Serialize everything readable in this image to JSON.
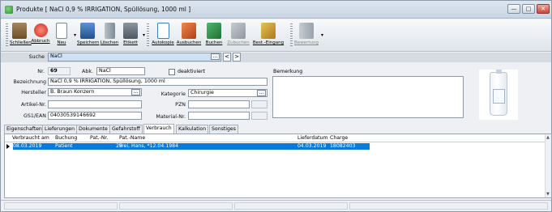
{
  "window": {
    "title": "Produkte [ NaCl 0,9 % IRRIGATION, Spüllösung, 1000 ml ]",
    "controls": {
      "minimize": "—",
      "maximize": "□",
      "close": "✕"
    }
  },
  "toolbar": {
    "buttons": [
      {
        "label": "Schließen",
        "icon": "exit-door-icon",
        "color": "#7a5a2e"
      },
      {
        "label": "Abbruch",
        "icon": "cancel-circle-icon",
        "color": "#d23a2e"
      },
      {
        "label": "Neu",
        "icon": "new-document-icon",
        "color": "#ffffff"
      },
      {
        "label": "Speichern",
        "icon": "floppy-disk-icon",
        "color": "#2f6fb5"
      },
      {
        "label": "Löschen",
        "icon": "trash-icon",
        "color": "#7f8b96"
      },
      {
        "label": "Etikett",
        "icon": "printer-icon",
        "color": "#5d6770"
      },
      {
        "label": "Autokopie",
        "icon": "copy-documents-icon",
        "color": "#3f7ec7"
      },
      {
        "label": "Ausbuchen",
        "icon": "book-out-icon",
        "color": "#d8572a"
      },
      {
        "label": "Buchen",
        "icon": "book-in-icon",
        "color": "#2a8f43"
      },
      {
        "label": "Zubuchen",
        "icon": "add-booking-icon",
        "color": "#9aa3ab"
      },
      {
        "label": "Best.-Eingang",
        "icon": "goods-receipt-icon",
        "color": "#c99a2a"
      },
      {
        "label": "Bewertung",
        "icon": "rating-chart-icon",
        "color": "#a7afb7"
      }
    ]
  },
  "search": {
    "label": "Suche",
    "value": "NaCl",
    "ellipsis": "...",
    "prev": "<",
    "next": ">"
  },
  "form": {
    "nr_label": "Nr.",
    "nr_value": "69",
    "abk_label": "Abk.",
    "abk_value": "NaCl",
    "deaktiviert_label": "deaktiviert",
    "bezeichnung_label": "Bezeichnung",
    "bezeichnung_value": "NaCl 0,9 % IRRIGATION, Spüllösung, 1000 ml",
    "hersteller_label": "Hersteller",
    "hersteller_value": "B. Braun Konzern",
    "kategorie_label": "Kategorie",
    "kategorie_value": "Chirurgie",
    "artikel_label": "Artikel-Nr.",
    "artikel_value": "",
    "pzn_label": "PZN",
    "pzn_value": "",
    "gs1_label": "GS1/EAN",
    "gs1_value": "04030539146692",
    "material_label": "Material-Nr.",
    "material_value": "",
    "bemerkung_label": "Bemerkung",
    "ellipsis": "..."
  },
  "tabs": [
    "Eigenschaften",
    "Lieferungen",
    "Dokumente",
    "Gefahrstoff",
    "Verbrauch",
    "Kalkulation",
    "Sonstiges"
  ],
  "active_tab": "Verbrauch",
  "table": {
    "columns": [
      "Verbraucht am",
      "Buchung",
      "Pat.-Nr.",
      "Pat.-Name",
      "Lieferdatum",
      "Charge"
    ],
    "rows": [
      [
        "08.03.2019",
        "Patient",
        "29",
        "Frei, Hans, *12.04.1984",
        "04.03.2019",
        "18082403"
      ]
    ]
  }
}
